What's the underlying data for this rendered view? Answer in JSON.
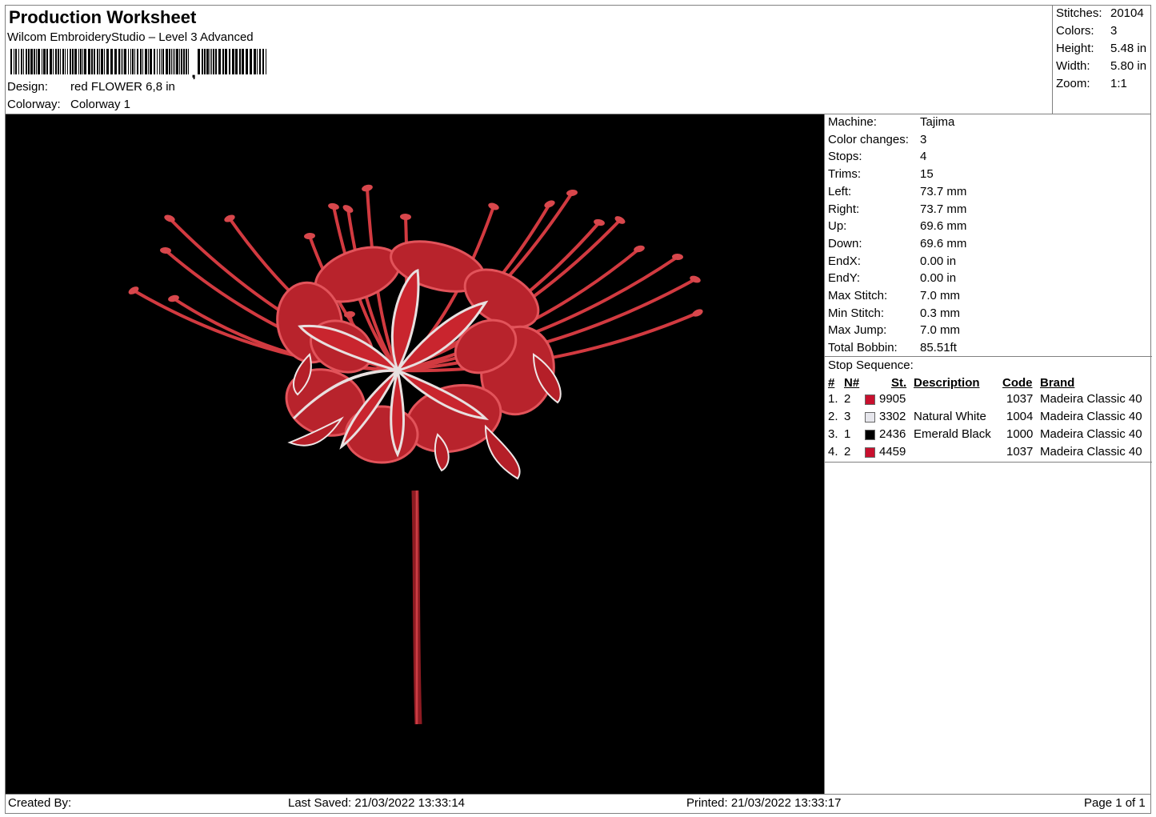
{
  "header": {
    "title": "Production Worksheet",
    "subtitle": "Wilcom EmbroideryStudio – Level 3 Advanced",
    "design_label": "Design:",
    "design_value": "red FLOWER 6,8 in",
    "colorway_label": "Colorway:",
    "colorway_value": "Colorway 1"
  },
  "stats": [
    {
      "label": "Stitches:",
      "value": "20104"
    },
    {
      "label": "Colors:",
      "value": "3"
    },
    {
      "label": "Height:",
      "value": "5.48 in"
    },
    {
      "label": "Width:",
      "value": "5.80 in"
    },
    {
      "label": "Zoom:",
      "value": "1:1"
    }
  ],
  "machine": [
    {
      "label": "Machine:",
      "value": "Tajima"
    },
    {
      "label": "Color changes:",
      "value": "3"
    },
    {
      "label": "Stops:",
      "value": "4"
    },
    {
      "label": "Trims:",
      "value": "15"
    },
    {
      "label": "Left:",
      "value": "73.7 mm"
    },
    {
      "label": "Right:",
      "value": "73.7 mm"
    },
    {
      "label": "Up:",
      "value": "69.6 mm"
    },
    {
      "label": "Down:",
      "value": "69.6 mm"
    },
    {
      "label": "EndX:",
      "value": "0.00 in"
    },
    {
      "label": "EndY:",
      "value": "0.00 in"
    },
    {
      "label": "Max Stitch:",
      "value": "7.0 mm"
    },
    {
      "label": "Min Stitch:",
      "value": "0.3 mm"
    },
    {
      "label": "Max Jump:",
      "value": "7.0 mm"
    },
    {
      "label": "Total Bobbin:",
      "value": "85.51ft"
    }
  ],
  "stop_sequence": {
    "title": "Stop Sequence:",
    "columns": {
      "num": "#",
      "n": "N#",
      "st": "St.",
      "description": "Description",
      "code": "Code",
      "brand": "Brand"
    },
    "rows": [
      {
        "num": "1.",
        "n": "2",
        "color": "#c8102e",
        "st": "9905",
        "description": "",
        "code": "1037",
        "brand": "Madeira Classic 40"
      },
      {
        "num": "2.",
        "n": "3",
        "color": "#e6e6ec",
        "st": "3302",
        "description": "Natural White",
        "code": "1004",
        "brand": "Madeira Classic 40"
      },
      {
        "num": "3.",
        "n": "1",
        "color": "#000000",
        "st": "2436",
        "description": "Emerald Black",
        "code": "1000",
        "brand": "Madeira Classic 40"
      },
      {
        "num": "4.",
        "n": "2",
        "color": "#c8102e",
        "st": "4459",
        "description": "",
        "code": "1037",
        "brand": "Madeira Classic 40"
      }
    ]
  },
  "footer": {
    "created_by": "Created By:",
    "last_saved": "Last Saved: 21/03/2022 13:33:14",
    "printed": "Printed: 21/03/2022 13:33:17",
    "page": "Page 1 of 1"
  },
  "colors": {
    "thread_red": "#c8102e",
    "canvas": "#000000",
    "border": "#808080"
  }
}
